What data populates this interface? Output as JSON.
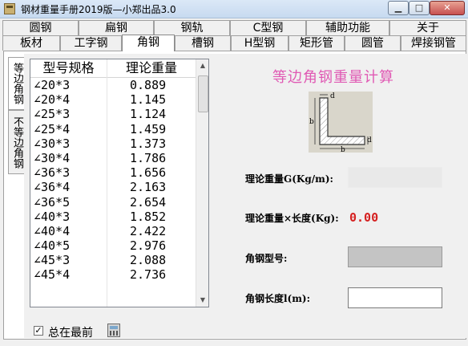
{
  "window": {
    "title": "钢材重量手册2019版—小郑出品3.0",
    "min_glyph": "▁",
    "max_glyph": "□",
    "close_glyph": "✕"
  },
  "tabs_row1": [
    {
      "label": "圆钢"
    },
    {
      "label": "扁钢"
    },
    {
      "label": "钢轨"
    },
    {
      "label": "C型钢"
    },
    {
      "label": "辅助功能"
    },
    {
      "label": "关于"
    }
  ],
  "tabs_row2": [
    {
      "label": "板材"
    },
    {
      "label": "工字钢"
    },
    {
      "label": "角钢",
      "active": true
    },
    {
      "label": "槽钢"
    },
    {
      "label": "H型钢"
    },
    {
      "label": "矩形管"
    },
    {
      "label": "圆管"
    },
    {
      "label": "焊接钢管"
    }
  ],
  "side_tabs": [
    {
      "label": "等边角钢",
      "active": true
    },
    {
      "label": "不等边角钢"
    }
  ],
  "list": {
    "headers": [
      "型号规格",
      "理论重量"
    ],
    "rows": [
      [
        "∠20*3",
        "0.889"
      ],
      [
        "∠20*4",
        "1.145"
      ],
      [
        "∠25*3",
        "1.124"
      ],
      [
        "∠25*4",
        "1.459"
      ],
      [
        "∠30*3",
        "1.373"
      ],
      [
        "∠30*4",
        "1.786"
      ],
      [
        "∠36*3",
        "1.656"
      ],
      [
        "∠36*4",
        "2.163"
      ],
      [
        "∠36*5",
        "2.654"
      ],
      [
        "∠40*3",
        "1.852"
      ],
      [
        "∠40*4",
        "2.422"
      ],
      [
        "∠40*5",
        "2.976"
      ],
      [
        "∠45*3",
        "2.088"
      ],
      [
        "∠45*4",
        "2.736"
      ]
    ]
  },
  "always_on_top": {
    "label": "总在最前",
    "checked": true,
    "check_glyph": "✓"
  },
  "calculator": {
    "title": "等边角钢重量计算",
    "diagram_labels": {
      "top": "d",
      "left": "b",
      "bottom": "b",
      "right": "d"
    },
    "weight_label": "理论重量G(Kg/m):",
    "weight_value": "",
    "total_label": "理论重量×长度(Kg):",
    "total_value": "0.00",
    "model_label": "角钢型号:",
    "model_value": "",
    "length_label": "角钢长度l(m):",
    "length_value": ""
  }
}
